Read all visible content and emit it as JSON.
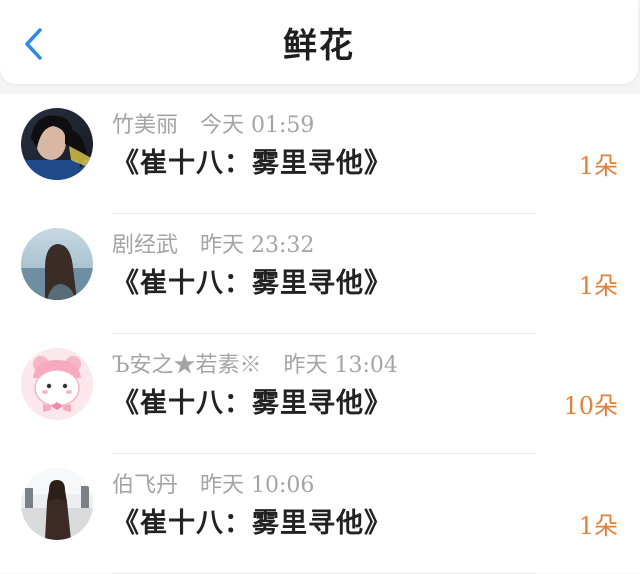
{
  "header": {
    "title": "鲜花",
    "back_icon": "chevron-left-icon",
    "accent_color": "#2f8ce5"
  },
  "flowers": {
    "items": [
      {
        "name": "竹美丽",
        "time": "今天 01:59",
        "work": "《崔十八：雾里寻他》",
        "count": "1朵",
        "avatar_icon": "user-avatar-photo"
      },
      {
        "name": "剧经武",
        "time": "昨天 23:32",
        "work": "《崔十八：雾里寻他》",
        "count": "1朵",
        "avatar_icon": "user-avatar-photo"
      },
      {
        "name": "Ъ安之★若素※",
        "time": "昨天 13:04",
        "work": "《崔十八：雾里寻他》",
        "count": "10朵",
        "avatar_icon": "user-avatar-cartoon"
      },
      {
        "name": "伯飞丹",
        "time": "昨天 10:06",
        "work": "《崔十八：雾里寻他》",
        "count": "1朵",
        "avatar_icon": "user-avatar-photo"
      }
    ],
    "count_color": "#e0823a"
  }
}
